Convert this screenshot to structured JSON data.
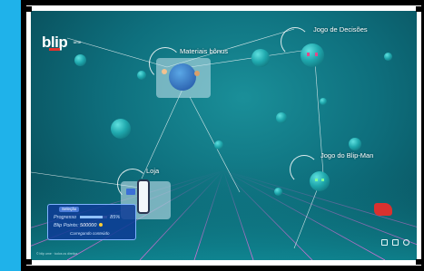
{
  "brand": {
    "logo_text": "blip",
    "logo_suffix": "ume"
  },
  "hotspots": {
    "materiais": "Materiais bônus",
    "decisoes": "Jogo de Decisões",
    "blipman": "Jogo do Blip-Man",
    "loja": "Loja"
  },
  "hud": {
    "chip": "Seleção",
    "progress_label": "Progresso",
    "progress_value": "85%",
    "points_label": "Blip Points:",
    "points_value": "500000",
    "sub": "Carregando conteúdo"
  },
  "footer_text": "© blip ume · todos os direitos",
  "controls": [
    "volume-icon",
    "fullscreen-icon",
    "settings-icon"
  ],
  "colors": {
    "accent": "#1fb2ea",
    "scene_dark": "#07434f",
    "hud": "#0e3c96"
  }
}
